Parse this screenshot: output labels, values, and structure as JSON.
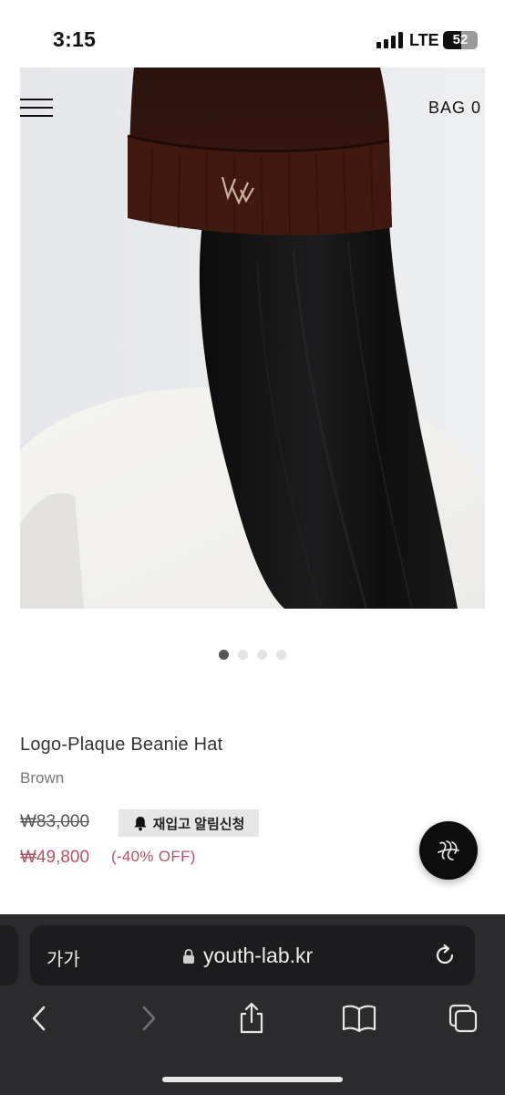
{
  "status_bar": {
    "time": "3:15",
    "network": "LTE",
    "battery": "52",
    "battery_level": 0.52
  },
  "header": {
    "menu_icon": "hamburger-menu-icon",
    "bag_label": "BAG 0"
  },
  "carousel": {
    "total_slides": 4,
    "active_index": 0
  },
  "product": {
    "title": "Logo-Plaque Beanie Hat",
    "color": "Brown",
    "original_price": "₩83,000",
    "restock_label": "재입고 알림신청",
    "sale_price": "₩49,800",
    "discount": "(-40% OFF)"
  },
  "safari": {
    "text_size_label": "가가",
    "url": "youth-lab.kr"
  },
  "colors": {
    "sale": "#b4536b",
    "beanie": "#3e1a12",
    "safari_bar": "#2b2b2d"
  }
}
